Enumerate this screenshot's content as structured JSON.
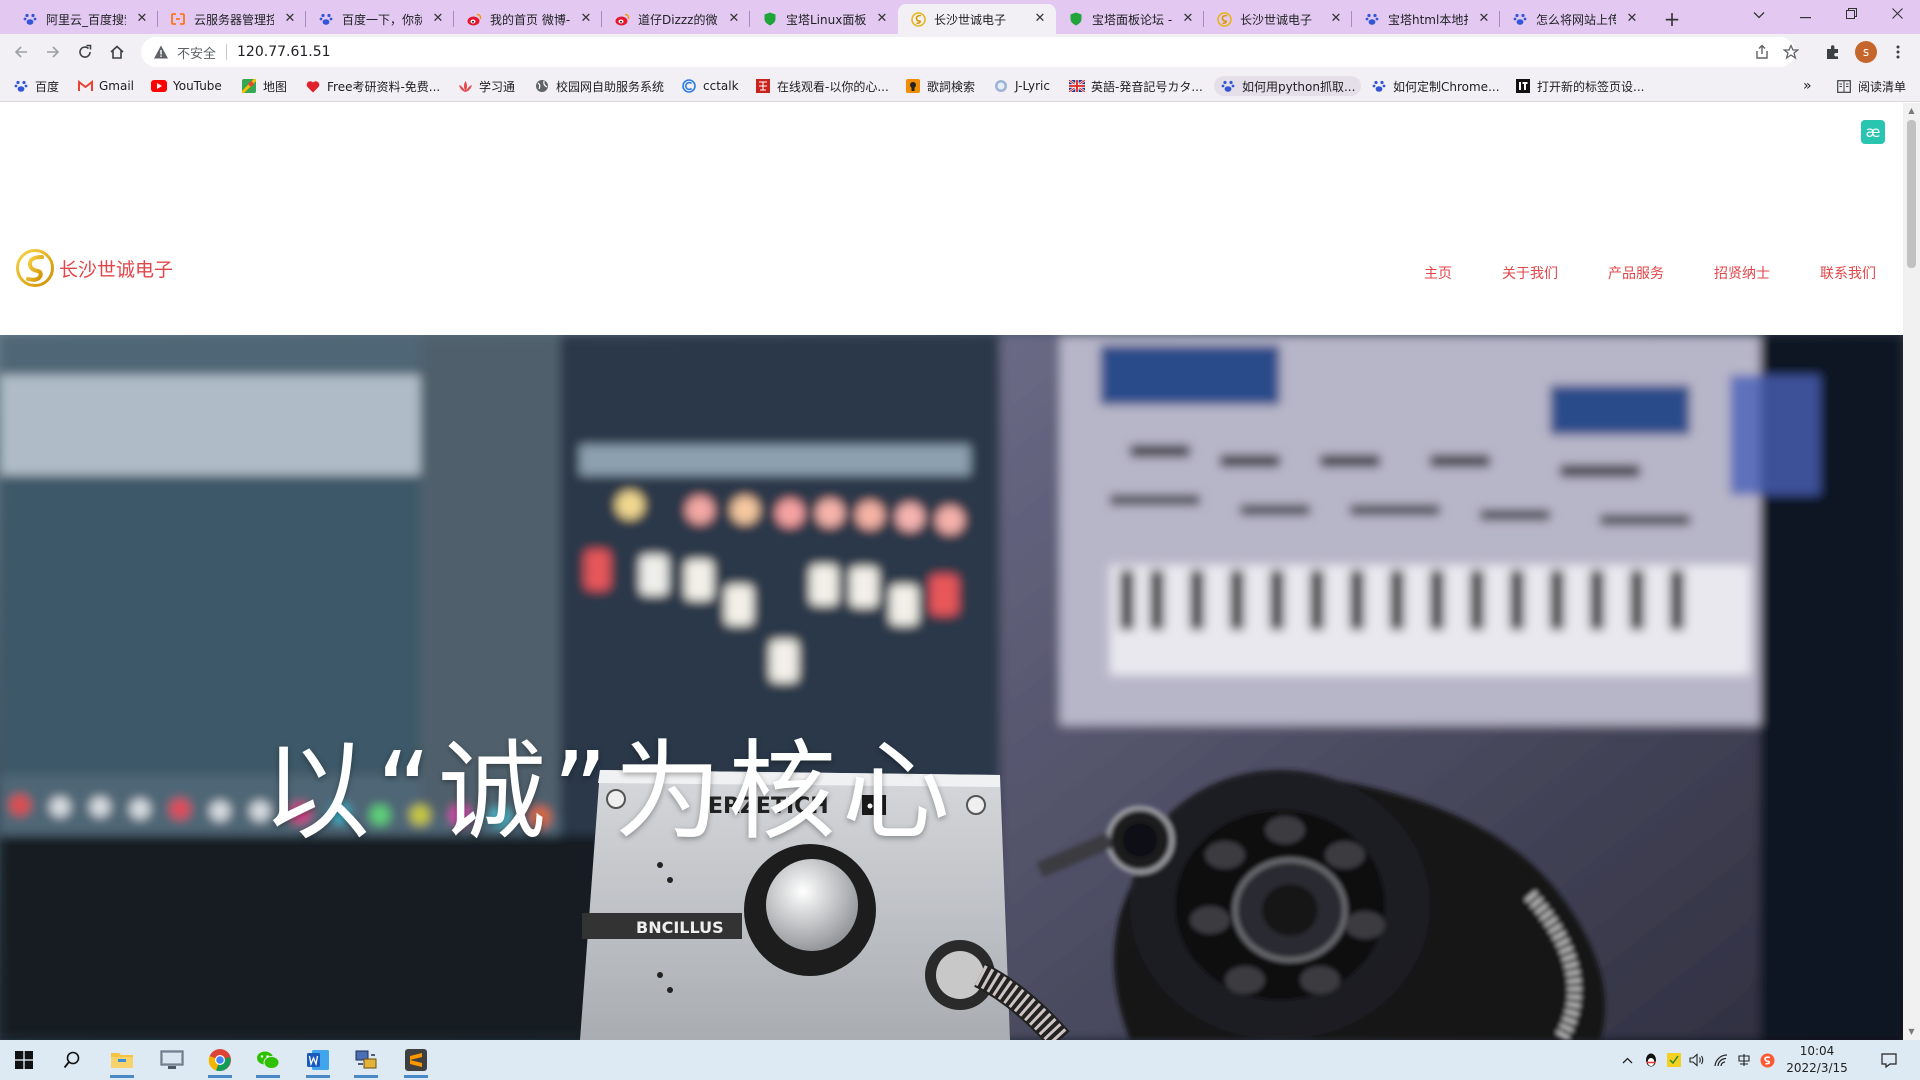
{
  "browser": {
    "tabs": [
      {
        "title": "阿里云_百度搜索",
        "icon": "paw-icon"
      },
      {
        "title": "云服务器管理控",
        "icon": "aliyun-icon"
      },
      {
        "title": "百度一下，你就",
        "icon": "paw-icon"
      },
      {
        "title": "我的首页 微博-随",
        "icon": "weibo-icon"
      },
      {
        "title": "道仔Dizzz的微博",
        "icon": "weibo-icon"
      },
      {
        "title": "宝塔Linux面板",
        "icon": "shield-icon"
      },
      {
        "title": "长沙世诚电子",
        "icon": "site-logo-icon",
        "active": true
      },
      {
        "title": "宝塔面板论坛 -",
        "icon": "shield-icon"
      },
      {
        "title": "长沙世诚电子",
        "icon": "site-logo-icon"
      },
      {
        "title": "宝塔html本地打",
        "icon": "paw-icon"
      },
      {
        "title": "怎么将网站上传",
        "icon": "paw-icon"
      }
    ],
    "address": {
      "security_label": "不安全",
      "url": "120.77.61.51"
    },
    "profile_initial": "s",
    "bookmarks": [
      {
        "label": "百度",
        "icon": "paw-icon"
      },
      {
        "label": "Gmail",
        "icon": "gmail-icon"
      },
      {
        "label": "YouTube",
        "icon": "youtube-icon"
      },
      {
        "label": "地图",
        "icon": "maps-icon"
      },
      {
        "label": "Free考研资料-免费...",
        "icon": "heart-icon"
      },
      {
        "label": "学习通",
        "icon": "lotus-icon"
      },
      {
        "label": "校园网自助服务系统",
        "icon": "globe-icon"
      },
      {
        "label": "cctalk",
        "icon": "cctalk-icon"
      },
      {
        "label": "在线观看-以你的心...",
        "icon": "red-square-icon"
      },
      {
        "label": "歌詞検索",
        "icon": "orange-lyrics-icon"
      },
      {
        "label": "J-Lyric",
        "icon": "jlyric-icon"
      },
      {
        "label": "英語-発音記号カタ...",
        "icon": "uk-flag-icon"
      },
      {
        "label": "如何用python抓取...",
        "icon": "paw-icon"
      },
      {
        "label": "如何定制Chrome...",
        "icon": "paw-icon"
      },
      {
        "label": "打开新的标签页设...",
        "icon": "it-icon"
      }
    ],
    "more_bookmarks": "»",
    "reading_list": "阅读清单"
  },
  "site": {
    "brand": "长沙世诚电子",
    "nav": [
      "主页",
      "关于我们",
      "产品服务",
      "招贤纳士",
      "联系我们"
    ],
    "hero_title": "以“诚”为核心",
    "hero_device_text": [
      "ERZETICH",
      "BNCILLUS"
    ],
    "badge_glyph": "æ",
    "accent_color": "#e2464a"
  },
  "taskbar": {
    "time": "10:04",
    "date": "2022/3/15"
  }
}
